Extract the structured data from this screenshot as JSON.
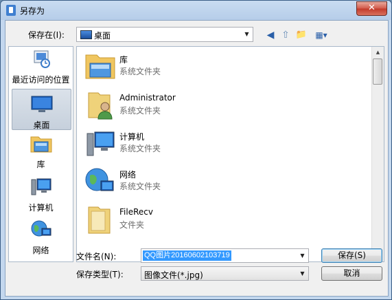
{
  "window": {
    "title": "另存为",
    "close_label": "✕"
  },
  "save_in": {
    "label": "保存在(I):",
    "location": "桌面"
  },
  "toolbar": {
    "back": "◀",
    "up": "⇧",
    "new_folder": "📁",
    "view": "▦▾"
  },
  "places": [
    {
      "label": "最近访问的位置",
      "icon": "recent-places-icon"
    },
    {
      "label": "桌面",
      "icon": "desktop-icon"
    },
    {
      "label": "库",
      "icon": "library-icon"
    },
    {
      "label": "计算机",
      "icon": "computer-icon"
    },
    {
      "label": "网络",
      "icon": "network-icon"
    }
  ],
  "files": [
    {
      "name": "库",
      "type": "系统文件夹",
      "icon": "library-icon"
    },
    {
      "name": "Administrator",
      "type": "系统文件夹",
      "icon": "user-folder-icon"
    },
    {
      "name": "计算机",
      "type": "系统文件夹",
      "icon": "computer-icon"
    },
    {
      "name": "网络",
      "type": "系统文件夹",
      "icon": "network-icon"
    },
    {
      "name": "FileRecv",
      "type": "文件夹",
      "icon": "folder-icon"
    }
  ],
  "filename": {
    "label": "文件名(N):",
    "value": "QQ图片20160602103719"
  },
  "filetype": {
    "label": "保存类型(T):",
    "value": "图像文件(*.jpg)"
  },
  "buttons": {
    "save": "保存(S)",
    "cancel": "取消"
  }
}
